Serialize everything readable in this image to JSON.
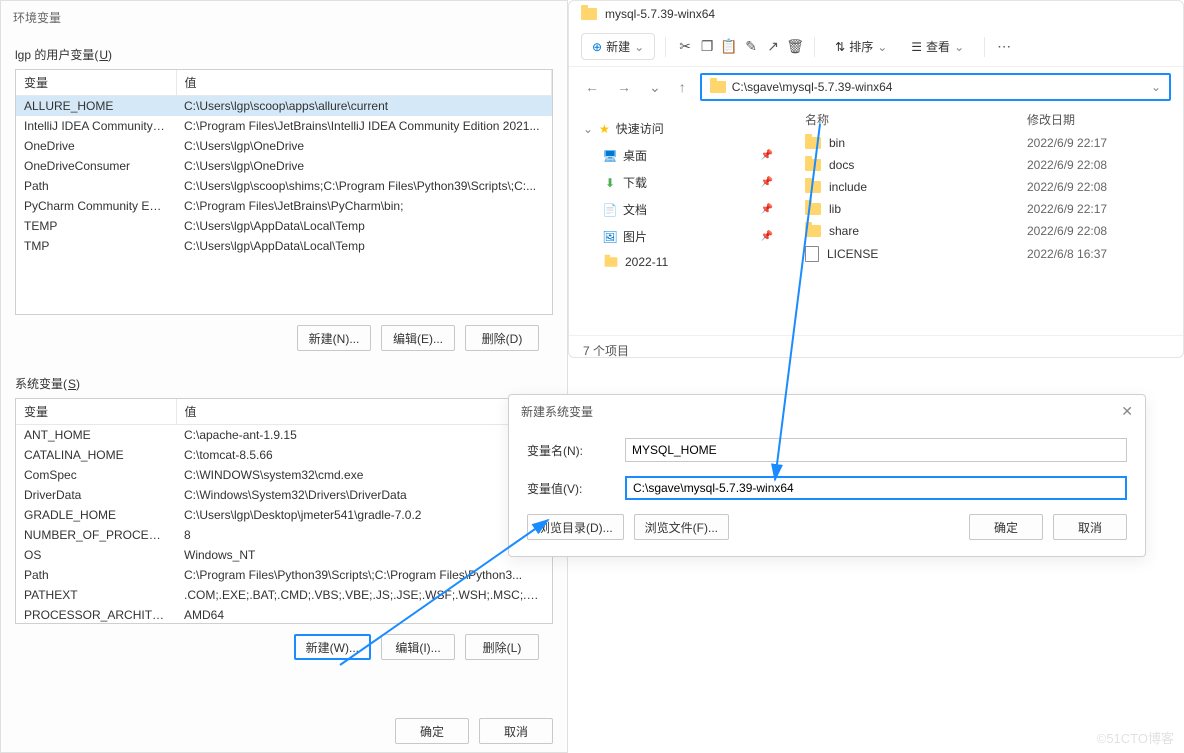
{
  "envDialog": {
    "title": "环境变量",
    "userSection": {
      "label_prefix": "lgp 的用户变量(",
      "hotkey": "U",
      "label_suffix": ")"
    },
    "sysSection": {
      "label_prefix": "系统变量(",
      "hotkey": "S",
      "label_suffix": ")"
    },
    "columns": {
      "var": "变量",
      "val": "值"
    },
    "userVars": [
      {
        "k": "ALLURE_HOME",
        "v": "C:\\Users\\lgp\\scoop\\apps\\allure\\current",
        "sel": true
      },
      {
        "k": "IntelliJ IDEA Community E...",
        "v": "C:\\Program Files\\JetBrains\\IntelliJ IDEA Community Edition 2021..."
      },
      {
        "k": "OneDrive",
        "v": "C:\\Users\\lgp\\OneDrive"
      },
      {
        "k": "OneDriveConsumer",
        "v": "C:\\Users\\lgp\\OneDrive"
      },
      {
        "k": "Path",
        "v": "C:\\Users\\lgp\\scoop\\shims;C:\\Program Files\\Python39\\Scripts\\;C:..."
      },
      {
        "k": "PyCharm Community Editi...",
        "v": "C:\\Program Files\\JetBrains\\PyCharm\\bin;"
      },
      {
        "k": "TEMP",
        "v": "C:\\Users\\lgp\\AppData\\Local\\Temp"
      },
      {
        "k": "TMP",
        "v": "C:\\Users\\lgp\\AppData\\Local\\Temp"
      }
    ],
    "sysVars": [
      {
        "k": "ANT_HOME",
        "v": "C:\\apache-ant-1.9.15"
      },
      {
        "k": "CATALINA_HOME",
        "v": "C:\\tomcat-8.5.66"
      },
      {
        "k": "ComSpec",
        "v": "C:\\WINDOWS\\system32\\cmd.exe"
      },
      {
        "k": "DriverData",
        "v": "C:\\Windows\\System32\\Drivers\\DriverData"
      },
      {
        "k": "GRADLE_HOME",
        "v": "C:\\Users\\lgp\\Desktop\\jmeter541\\gradle-7.0.2"
      },
      {
        "k": "NUMBER_OF_PROCESSORS",
        "v": "8"
      },
      {
        "k": "OS",
        "v": "Windows_NT"
      },
      {
        "k": "Path",
        "v": "C:\\Program Files\\Python39\\Scripts\\;C:\\Program Files\\Python3..."
      },
      {
        "k": "PATHEXT",
        "v": ".COM;.EXE;.BAT;.CMD;.VBS;.VBE;.JS;.JSE;.WSF;.WSH;.MSC;.PY;.P..."
      },
      {
        "k": "PROCESSOR_ARCHITECT...",
        "v": "AMD64"
      }
    ],
    "btns": {
      "new_u": "新建(N)...",
      "edit_u": "编辑(E)...",
      "del_u": "删除(D)",
      "new_s": "新建(W)...",
      "edit_s": "编辑(I)...",
      "del_s": "删除(L)",
      "ok": "确定",
      "cancel": "取消"
    }
  },
  "explorer": {
    "title": "mysql-5.7.39-winx64",
    "toolbar": {
      "new": "新建",
      "sort": "排序",
      "view": "查看"
    },
    "address": "C:\\sgave\\mysql-5.7.39-winx64",
    "tree": {
      "quick": "快速访问",
      "desktop": "桌面",
      "downloads": "下载",
      "documents": "文档",
      "pictures": "图片",
      "folder2022": "2022-11"
    },
    "cols": {
      "name": "名称",
      "date": "修改日期"
    },
    "files": [
      {
        "n": "bin",
        "d": "2022/6/9 22:17",
        "t": "folder"
      },
      {
        "n": "docs",
        "d": "2022/6/9 22:08",
        "t": "folder"
      },
      {
        "n": "include",
        "d": "2022/6/9 22:08",
        "t": "folder"
      },
      {
        "n": "lib",
        "d": "2022/6/9 22:17",
        "t": "folder"
      },
      {
        "n": "share",
        "d": "2022/6/9 22:08",
        "t": "folder"
      },
      {
        "n": "LICENSE",
        "d": "2022/6/8 16:37",
        "t": "file"
      }
    ],
    "status": "7 个项目"
  },
  "newVar": {
    "title": "新建系统变量",
    "name_label": "变量名(N):",
    "name_value": "MYSQL_HOME",
    "val_label": "变量值(V):",
    "val_value": "C:\\sgave\\mysql-5.7.39-winx64",
    "browse_dir": "浏览目录(D)...",
    "browse_file": "浏览文件(F)...",
    "ok": "确定",
    "cancel": "取消"
  },
  "watermark": "©51CTO博客"
}
